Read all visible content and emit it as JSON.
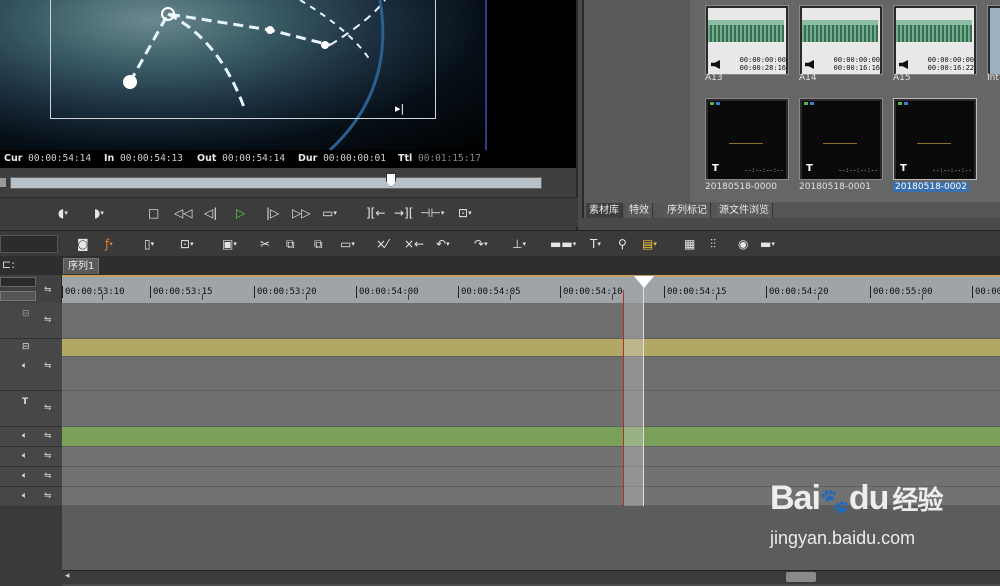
{
  "preview": {
    "timecodes": [
      {
        "label": "Cur",
        "value": "00:00:54:14"
      },
      {
        "label": "In",
        "value": "00:00:54:13"
      },
      {
        "label": "Out",
        "value": "00:00:54:14"
      },
      {
        "label": "Dur",
        "value": "00:00:00:01"
      },
      {
        "label": "Ttl",
        "value": "00:01:15:17"
      }
    ],
    "scrub_position_fraction": 0.72,
    "play_icon_color": "#5bd14a"
  },
  "bin": {
    "clips": [
      {
        "name": "A13",
        "time1": "00:00:00:00",
        "time2": "00:00:28:16",
        "kind": "audio"
      },
      {
        "name": "A14",
        "time1": "00:00:00:00",
        "time2": "00:00:16:16",
        "kind": "audio"
      },
      {
        "name": "A15",
        "time1": "00:00:00:00",
        "time2": "00:00:16:22",
        "kind": "audio"
      },
      {
        "name": "Int",
        "kind": "partial"
      },
      {
        "name": "20180518-0000",
        "kind": "title",
        "dash": "--:--:--:--"
      },
      {
        "name": "20180518-0001",
        "kind": "title",
        "dash": "--:--:--:--"
      },
      {
        "name": "20180518-0002",
        "kind": "title",
        "dash": "--:--:--:--",
        "selected": true
      }
    ],
    "tabs": [
      "素材库",
      "特效",
      "序列标记",
      "源文件浏览"
    ],
    "active_tab": 0
  },
  "timeline": {
    "sequence_tab": "序列1",
    "ruler_ticks": [
      "00:00:53:10",
      "00:00:53:15",
      "00:00:53:20",
      "00:00:54:00",
      "00:00:54:05",
      "00:00:54:10",
      "00:00:54:15",
      "00:00:54:20",
      "00:00:55:00",
      "00:00"
    ],
    "colors": {
      "video_clip": "#b3a766",
      "audio_clip": "#7ba05a",
      "track": "#727272"
    }
  },
  "watermark": {
    "brand": "Bai",
    "brand2": "du",
    "cn": "经验",
    "url": "jingyan.baidu.com"
  }
}
